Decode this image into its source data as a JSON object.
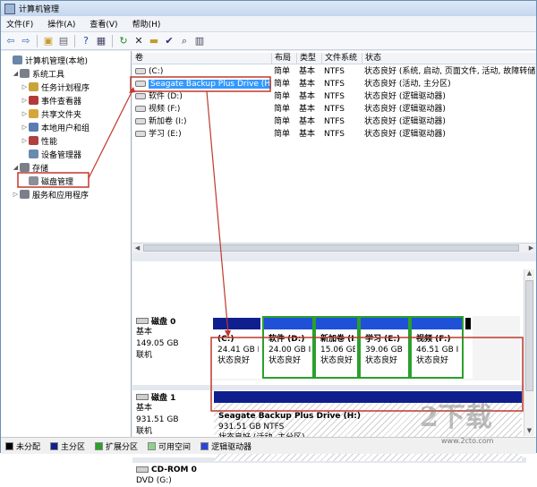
{
  "window": {
    "title": "计算机管理"
  },
  "menu": [
    "文件(F)",
    "操作(A)",
    "查看(V)",
    "帮助(H)"
  ],
  "toolbar": [
    {
      "name": "back-arrow-icon",
      "glyph": "⇦",
      "color": "#2f6fb4"
    },
    {
      "name": "forward-arrow-icon",
      "glyph": "⇨",
      "color": "#2f6fb4"
    },
    {
      "sep": true
    },
    {
      "name": "up-folder-icon",
      "glyph": "▣",
      "color": "#c79a2a"
    },
    {
      "name": "show-tree-icon",
      "glyph": "▤",
      "color": "#667"
    },
    {
      "sep": true
    },
    {
      "name": "help-icon",
      "glyph": "?",
      "color": "#1d4ea0"
    },
    {
      "name": "properties-icon",
      "glyph": "▦",
      "color": "#446"
    },
    {
      "sep": true
    },
    {
      "name": "refresh-icon",
      "glyph": "↻",
      "color": "#2b8a2b"
    },
    {
      "name": "delete-icon",
      "glyph": "✕",
      "color": "#222"
    },
    {
      "name": "open-folder-icon",
      "glyph": "▬",
      "color": "#c79a2a"
    },
    {
      "name": "check-icon",
      "glyph": "✔",
      "color": "#2b2b7a"
    },
    {
      "name": "search-icon",
      "glyph": "⌕",
      "color": "#333"
    },
    {
      "name": "view-icon",
      "glyph": "▥",
      "color": "#445"
    }
  ],
  "tree": [
    {
      "label": "计算机管理(本地)",
      "icon": "computer-icon",
      "color": "#6a86a8",
      "expander": ""
    },
    {
      "label": "系统工具",
      "icon": "tools-icon",
      "color": "#7a7f8a",
      "expander": "◢"
    },
    {
      "label": "任务计划程序",
      "icon": "clock-icon",
      "color": "#c8a43a",
      "expander": "▷"
    },
    {
      "label": "事件查看器",
      "icon": "event-viewer-icon",
      "color": "#b23a3a",
      "expander": "▷"
    },
    {
      "label": "共享文件夹",
      "icon": "shared-folder-icon",
      "color": "#d6a63a",
      "expander": "▷"
    },
    {
      "label": "本地用户和组",
      "icon": "users-icon",
      "color": "#5a7cb0",
      "expander": "▷"
    },
    {
      "label": "性能",
      "icon": "performance-icon",
      "color": "#b04040",
      "expander": "▷"
    },
    {
      "label": "设备管理器",
      "icon": "device-manager-icon",
      "color": "#6a8ab0",
      "expander": ""
    },
    {
      "label": "存储",
      "icon": "storage-icon",
      "color": "#7a7f8a",
      "expander": "◢"
    },
    {
      "label": "磁盘管理",
      "icon": "disk-management-icon",
      "color": "#8a8f99",
      "expander": ""
    },
    {
      "label": "服务和应用程序",
      "icon": "services-icon",
      "color": "#7a7f8a",
      "expander": "▷"
    }
  ],
  "volume_table": {
    "headers": [
      "卷",
      "布局",
      "类型",
      "文件系统",
      "状态"
    ],
    "rows": [
      {
        "volume": "(C:)",
        "layout": "简单",
        "type": "基本",
        "fs": "NTFS",
        "status": "状态良好 (系统, 启动, 页面文件, 活动, 故障转储"
      },
      {
        "volume": "Seagate Backup Plus Drive (H:)",
        "layout": "简单",
        "type": "基本",
        "fs": "NTFS",
        "status": "状态良好 (活动, 主分区)"
      },
      {
        "volume": "软件 (D:)",
        "layout": "简单",
        "type": "基本",
        "fs": "NTFS",
        "status": "状态良好 (逻辑驱动器)"
      },
      {
        "volume": "视频 (F:)",
        "layout": "简单",
        "type": "基本",
        "fs": "NTFS",
        "status": "状态良好 (逻辑驱动器)"
      },
      {
        "volume": "新加卷 (I:)",
        "layout": "简单",
        "type": "基本",
        "fs": "NTFS",
        "status": "状态良好 (逻辑驱动器)"
      },
      {
        "volume": "学习 (E:)",
        "layout": "简单",
        "type": "基本",
        "fs": "NTFS",
        "status": "状态良好 (逻辑驱动器)"
      }
    ]
  },
  "disks": [
    {
      "name": "磁盘 0",
      "type": "基本",
      "size": "149.05 GB",
      "status": "联机",
      "partitions": [
        {
          "label": "(C:)",
          "size": "24.41 GB I",
          "status": "状态良好",
          "bar": "#101f8e",
          "frame": "#ffffff"
        },
        {
          "label": "软件  (D:)",
          "size": "24.00 GB I",
          "status": "状态良好",
          "bar": "#1f50d8",
          "frame": "#2ba02b"
        },
        {
          "label": "新加卷  (I:",
          "size": "15.06 GB",
          "status": "状态良好",
          "bar": "#1f50d8",
          "frame": "#2ba02b"
        },
        {
          "label": "学习  (E:)",
          "size": "39.06 GB",
          "status": "状态良好",
          "bar": "#1f50d8",
          "frame": "#2ba02b"
        },
        {
          "label": "视频  (F:)",
          "size": "46.51 GB I",
          "status": "状态良好",
          "bar": "#1f50d8",
          "frame": "#2ba02b"
        },
        {
          "label": "",
          "size": "",
          "status": "",
          "bar": "#000000",
          "frame": "#ffffff"
        }
      ]
    },
    {
      "name": "磁盘 1",
      "type": "基本",
      "size": "931.51 GB",
      "status": "联机",
      "partition": {
        "label": "Seagate Backup Plus Drive  (H:)",
        "size": "931.51 GB NTFS",
        "status": "状态良好 (活动, 主分区)",
        "bar": "#101f8e"
      }
    },
    {
      "name": "CD-ROM 0",
      "type": "DVD (G:)"
    }
  ],
  "legend": [
    {
      "label": "未分配",
      "color": "#000000"
    },
    {
      "label": "主分区",
      "color": "#101f8e"
    },
    {
      "label": "扩展分区",
      "color": "#2ba02b"
    },
    {
      "label": "可用空间",
      "color": "#8fd18f"
    },
    {
      "label": "逻辑驱动器",
      "color": "#2b44d8"
    }
  ],
  "watermark": {
    "text": "2下载",
    "url": "www.2cto.com"
  },
  "colors": {
    "highlight": "#3399ff",
    "annotation": "#c0392b"
  }
}
